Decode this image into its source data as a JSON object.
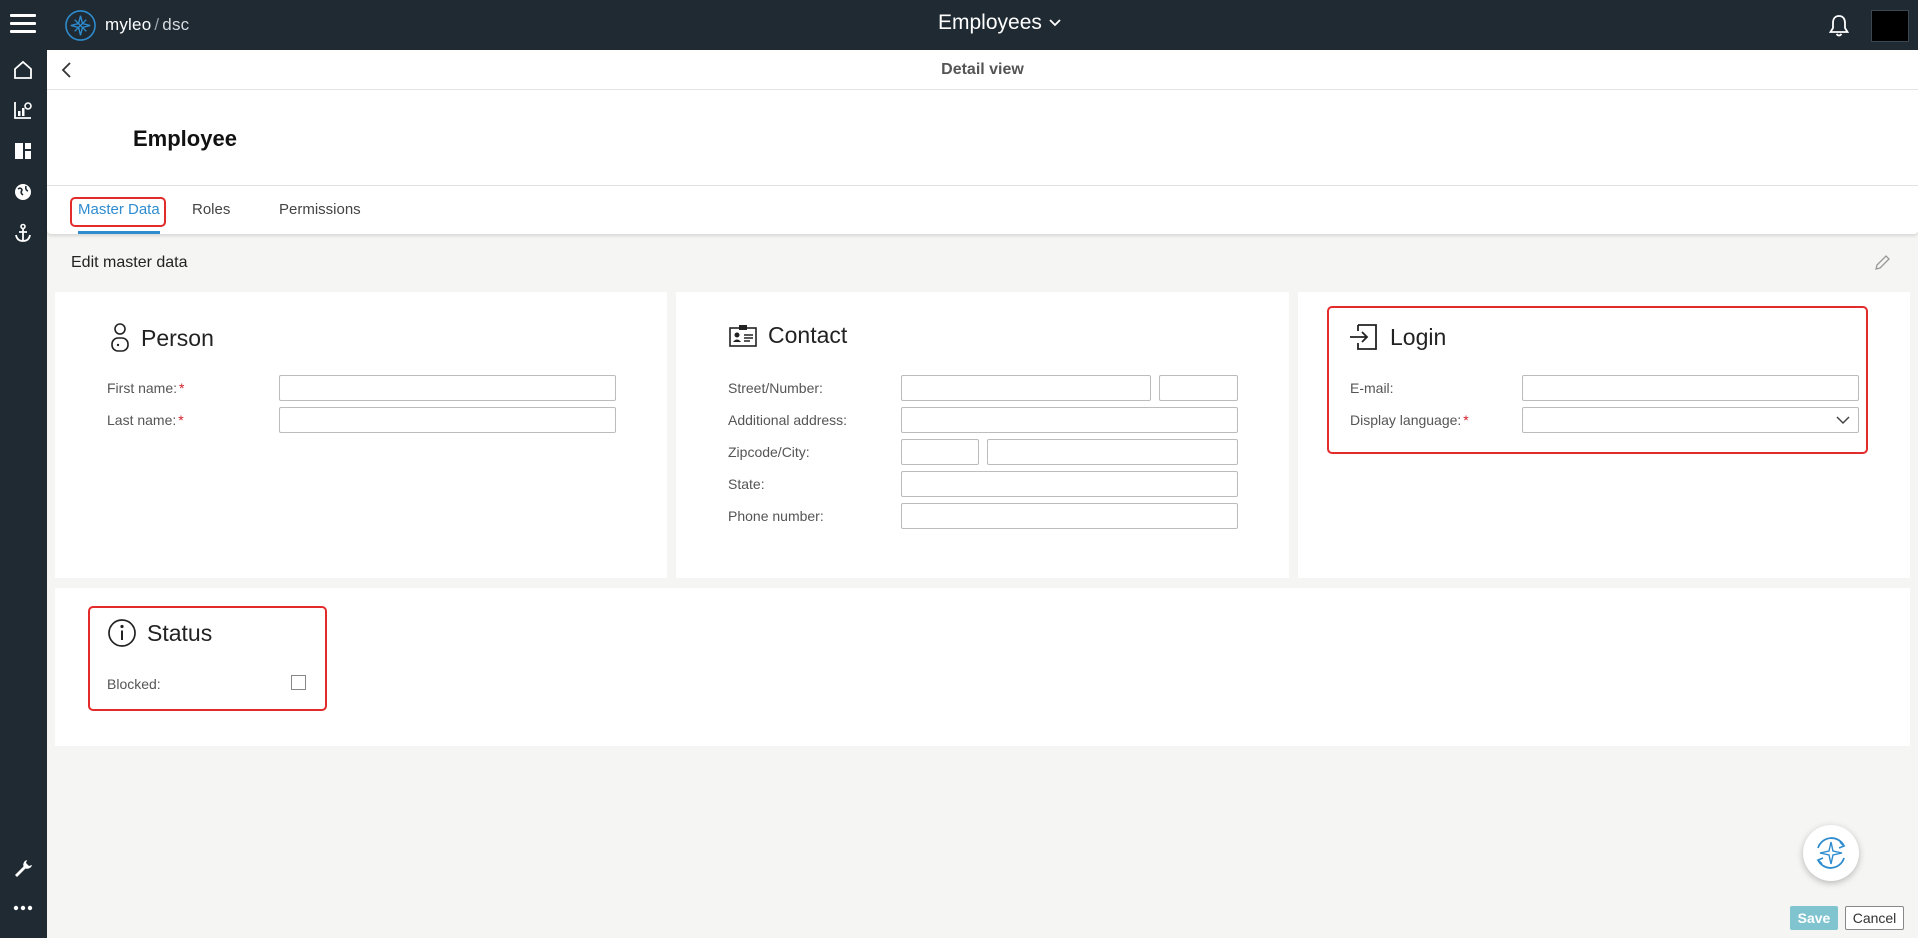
{
  "topbar": {
    "brand_name": "myleo",
    "brand_separator": "/",
    "brand_suffix": "dsc",
    "app_title": "Employees"
  },
  "detail": {
    "title": "Detail view",
    "entity_title": "Employee"
  },
  "tabs": [
    {
      "label": "Master Data",
      "active": true
    },
    {
      "label": "Roles",
      "active": false
    },
    {
      "label": "Permissions",
      "active": false
    }
  ],
  "section": {
    "title": "Edit master data"
  },
  "person": {
    "title": "Person",
    "first_name_label": "First name:",
    "last_name_label": "Last name:",
    "required_mark": "*"
  },
  "contact": {
    "title": "Contact",
    "street_label": "Street/Number:",
    "additional_label": "Additional address:",
    "zip_label": "Zipcode/City:",
    "state_label": "State:",
    "phone_label": "Phone number:"
  },
  "login": {
    "title": "Login",
    "email_label": "E-mail:",
    "language_label": "Display language:",
    "required_mark": "*"
  },
  "status": {
    "title": "Status",
    "blocked_label": "Blocked:"
  },
  "footer": {
    "save_label": "Save",
    "cancel_label": "Cancel"
  },
  "colors": {
    "topbar": "#1f2a33",
    "accent": "#2e8ccf",
    "highlight": "#e32b2b",
    "save_button": "#7fc4cf"
  }
}
